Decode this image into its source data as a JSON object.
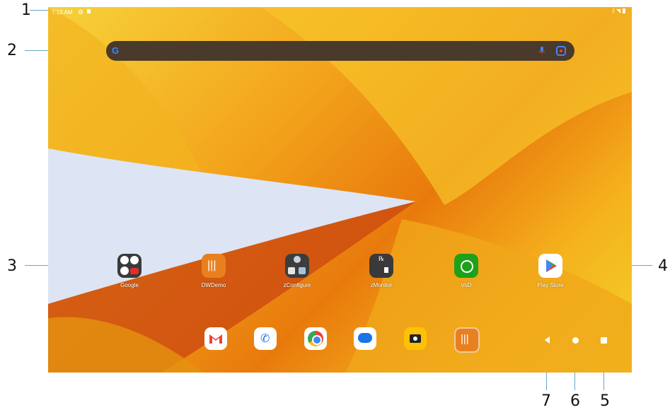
{
  "status_bar": {
    "time": "7:13 AM",
    "settings_icon": "gear-icon",
    "sd_icon": "sdcard-icon",
    "right_icons": [
      "bluetooth-icon",
      "wifi-icon",
      "battery-icon"
    ]
  },
  "search": {
    "logo": "G",
    "icons": [
      "mic-icon",
      "lens-icon"
    ]
  },
  "apps": [
    {
      "label": "Google"
    },
    {
      "label": "DWDemo"
    },
    {
      "label": "zConfigure"
    },
    {
      "label": "zMonitor"
    },
    {
      "label": "VoD"
    },
    {
      "label": "Play Store"
    }
  ],
  "dock": [
    "gmail-icon",
    "phone-icon",
    "chrome-icon",
    "messages-icon",
    "camera-icon",
    "dwdemo-icon"
  ],
  "nav": [
    "back-icon",
    "home-icon",
    "recents-icon"
  ],
  "callouts": [
    "1",
    "2",
    "3",
    "4",
    "5",
    "6",
    "7"
  ],
  "colors": {
    "searchbar": "#4a3a2c",
    "callout_line": "#6aa6c8"
  }
}
